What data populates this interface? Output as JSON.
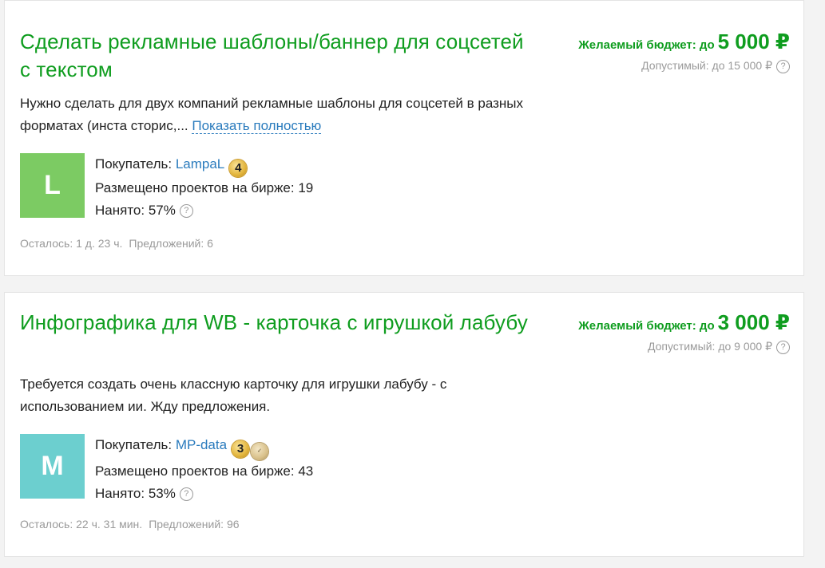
{
  "colors": {
    "accent_green": "#0f9d1f",
    "link_blue": "#2a7bbd",
    "muted_gray": "#9a9a9a"
  },
  "projects": [
    {
      "title": "Сделать рекламные шаблоны/баннер для соцсетей с текстом",
      "budget_label": "Желаемый бюджет: до",
      "budget_amount": "5 000 ₽",
      "allowed_text": "Допустимый: до 15 000 ₽",
      "description": "Нужно сделать для двух компаний рекламные шаблоны для соцсетей в разных форматах (инста сторис,... ",
      "more_label": "Показать полностью",
      "avatar_letter": "L",
      "avatar_color": "#7ccb63",
      "buyer_label": "Покупатель:",
      "buyer_name": "LampaL",
      "buyer_badge": "4",
      "posted_text": "Размещено проектов на бирже: 19",
      "hired_text": "Нанято: 57%",
      "time_left": "Осталось: 1 д. 23 ч.",
      "offers": "Предложений: 6"
    },
    {
      "title": "Инфографика для WB - карточка с игрушкой лабубу",
      "budget_label": "Желаемый бюджет: до",
      "budget_amount": "3 000 ₽",
      "allowed_text": "Допустимый: до 9 000 ₽",
      "description": "Требуется создать очень классную карточку для игрушки лабубу - с использованием ии. Жду предложения.",
      "avatar_letter": "M",
      "avatar_color": "#6ccfcf",
      "buyer_label": "Покупатель:",
      "buyer_name": "MP-data",
      "buyer_badge": "3",
      "posted_text": "Размещено проектов на бирже: 43",
      "hired_text": "Нанято: 53%",
      "time_left": "Осталось: 22 ч. 31 мин.",
      "offers": "Предложений: 96"
    }
  ],
  "help_glyph": "?",
  "icons": {
    "help": "question-circle-icon",
    "badge": "level-badge-icon",
    "seal": "verified-seal-icon"
  }
}
